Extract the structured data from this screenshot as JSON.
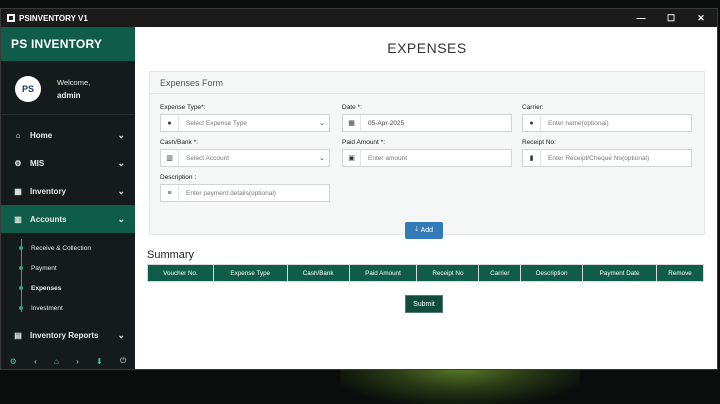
{
  "window": {
    "title": "PSINVENTORY V1",
    "controls": [
      "—",
      "☐",
      "✕"
    ]
  },
  "sidebar": {
    "brand": "PS INVENTORY",
    "avatar_initials": "PS",
    "welcome": "Welcome,",
    "username": "admin",
    "items": [
      {
        "label": "Home",
        "icon": "home-icon"
      },
      {
        "label": "MIS",
        "icon": "gears-icon"
      },
      {
        "label": "Inventory",
        "icon": "table-icon"
      },
      {
        "label": "Accounts",
        "icon": "bar-chart-icon"
      }
    ],
    "subitems": [
      {
        "label": "Receive & Collection"
      },
      {
        "label": "Payment"
      },
      {
        "label": "Expenses"
      },
      {
        "label": "Investment"
      }
    ],
    "after_items": [
      {
        "label": "Inventory Reports",
        "icon": "report-icon"
      }
    ],
    "footer_icons": [
      "settings-icon",
      "back-icon",
      "home-icon",
      "forward-icon",
      "download-icon",
      "power-icon"
    ]
  },
  "main": {
    "title": "EXPENSES",
    "form": {
      "title": "Expenses Form",
      "expense_type": {
        "label": "Expense Type*:",
        "placeholder": "Select Expense Type"
      },
      "date": {
        "label": "Date *:",
        "value": "05-Apr-2025"
      },
      "carrier": {
        "label": "Carrier:",
        "placeholder": "Enter name(optional)"
      },
      "cash_bank": {
        "label": "Cash/Bank *:",
        "placeholder": "Select Account"
      },
      "paid_amount": {
        "label": "Paid Amount *:",
        "placeholder": "Enter amount"
      },
      "receipt_no": {
        "label": "Receipt No:",
        "placeholder": "Enter Receipt/Cheque No(optional)"
      },
      "description": {
        "label": "Description :",
        "placeholder": "Enter payment details(optional)"
      },
      "add_label": "Add"
    },
    "summary": {
      "title": "Summary",
      "columns": [
        "Voucher No.",
        "Expense Type",
        "Cash/Bank",
        "Paid Amount",
        "Receipt No",
        "Carrier",
        "Description",
        "Payment Date",
        "Remove"
      ]
    },
    "submit_label": "Submit"
  },
  "colors": {
    "brand_green": "#0f5d49",
    "sidebar_bg": "#151a1b",
    "button_blue": "#337ab7",
    "submit_green": "#0f4c3b"
  }
}
